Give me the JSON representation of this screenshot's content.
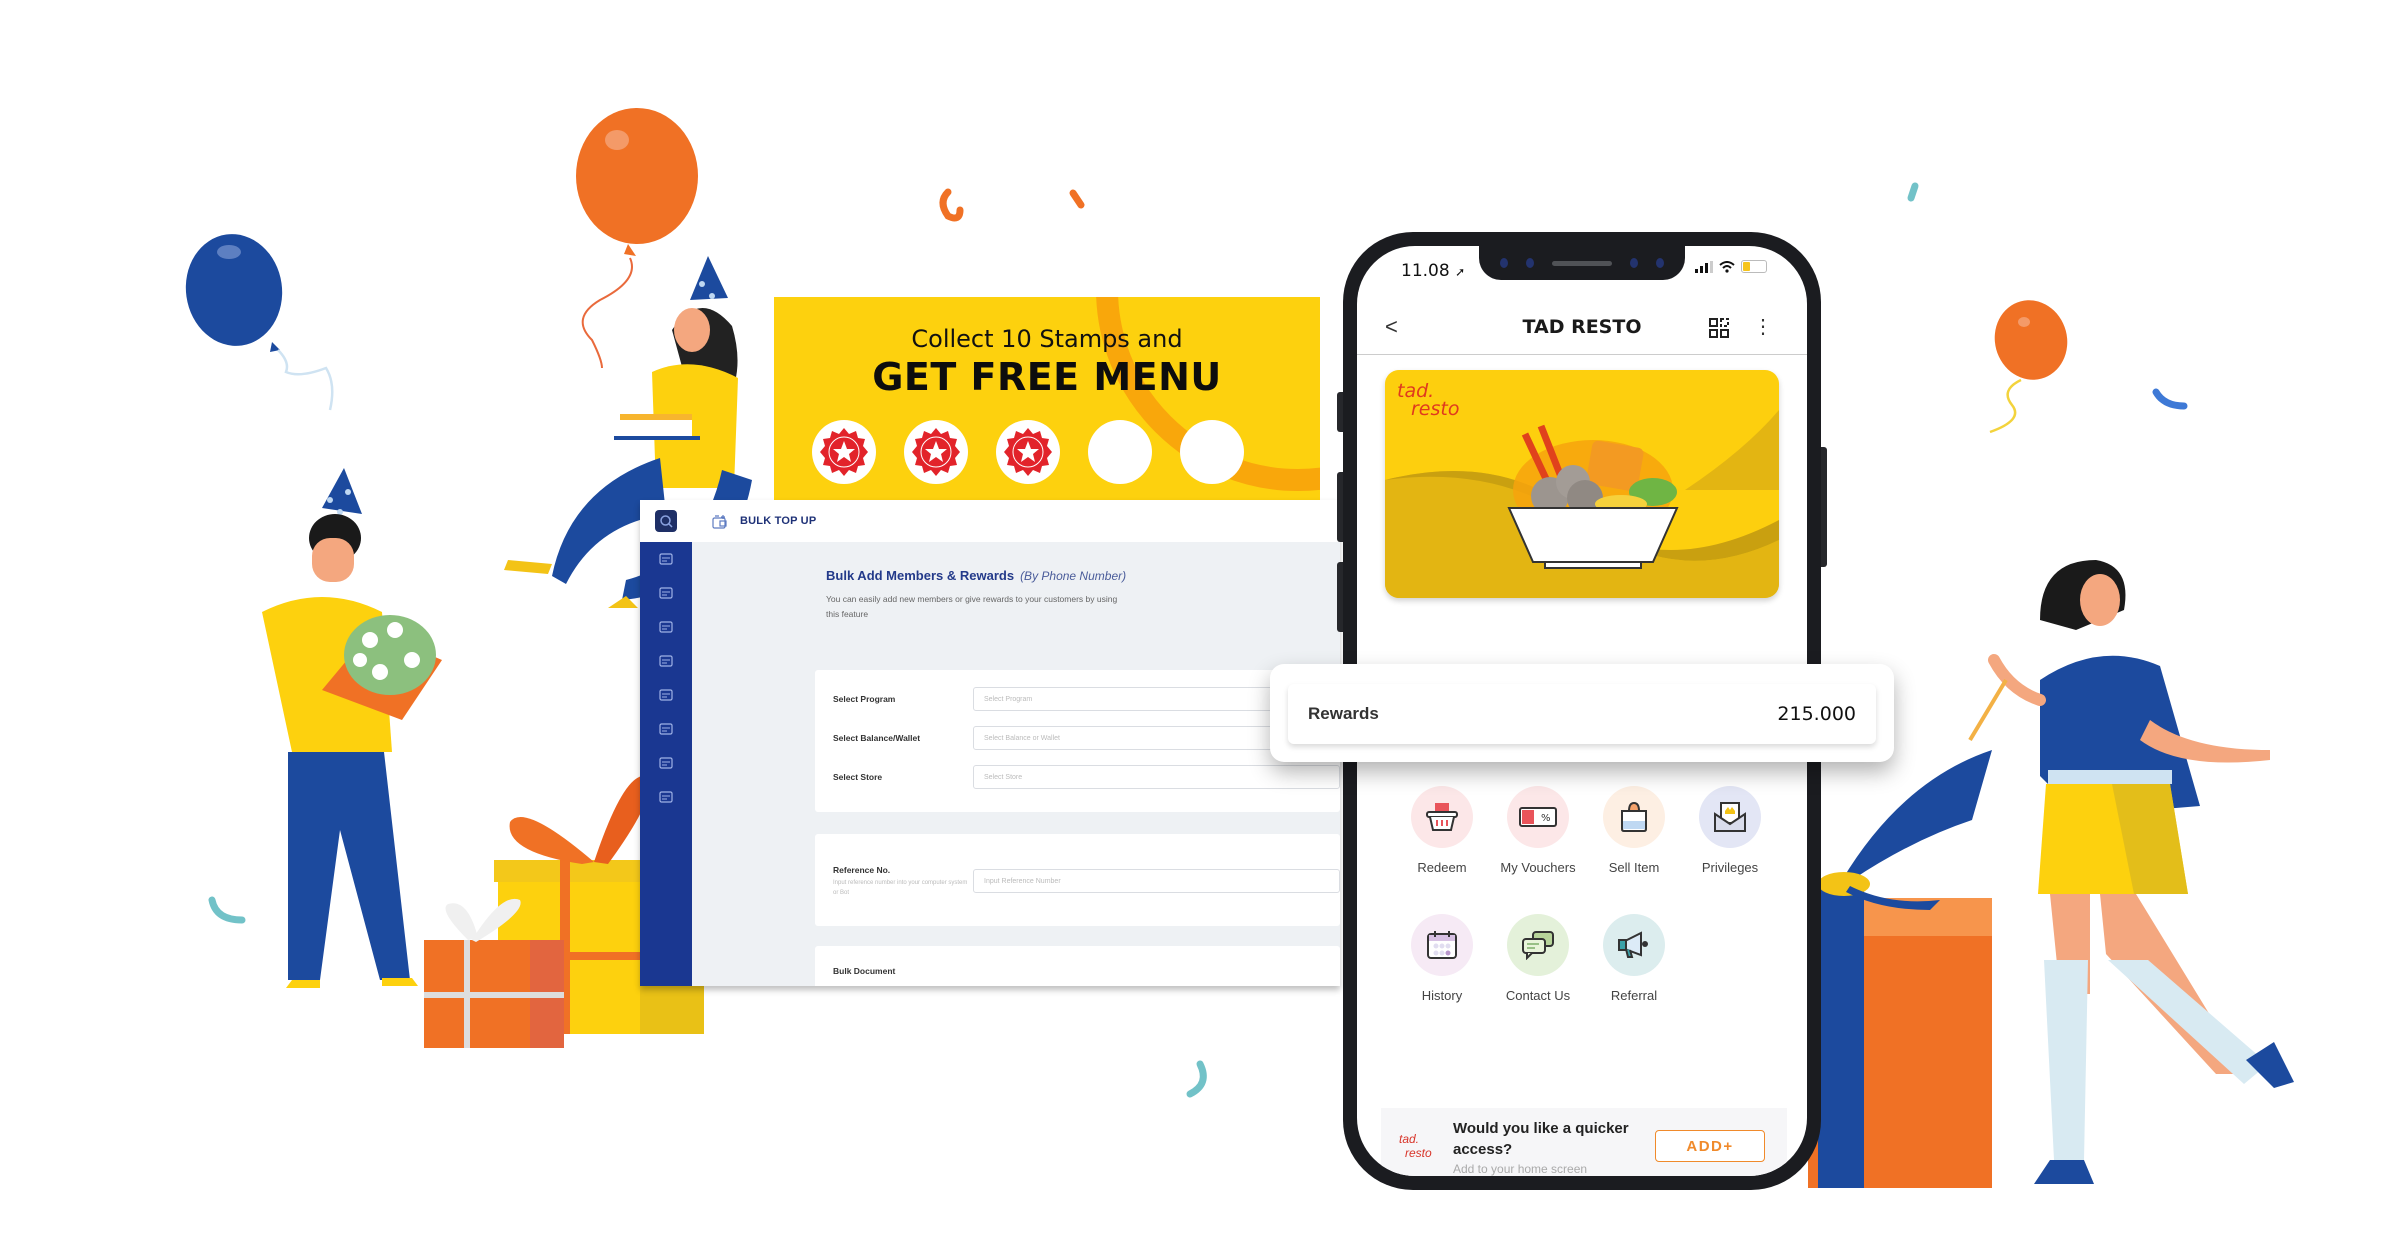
{
  "stamp_card": {
    "line1": "Collect 10 Stamps and",
    "line2": "GET FREE MENU",
    "stamps_collected": 3,
    "stamps_visible": 5,
    "colors": {
      "background": "#FDD10E",
      "arc": "#F9A70B",
      "stamp": "#E2232A"
    }
  },
  "dashboard": {
    "topbar_title": "BULK TOP UP",
    "heading": "Bulk Add Members & Rewards",
    "heading_sub": "(By Phone Number)",
    "description": "You can easily add new members or give rewards to your customers by using this feature",
    "sidebar_icons": [
      "search-logo-icon",
      "members-icon",
      "card-icon",
      "document-icon",
      "wallet-icon",
      "discount-icon",
      "store-icon",
      "report-icon",
      "settings-icon"
    ],
    "fields": [
      {
        "label": "Select Program",
        "placeholder": "Select Program"
      },
      {
        "label": "Select Balance/Wallet",
        "placeholder": "Select Balance or Wallet"
      },
      {
        "label": "Select Store",
        "placeholder": "Select Store"
      }
    ],
    "reference": {
      "label": "Reference No.",
      "hint": "Input reference number into your computer system or Bot",
      "placeholder": "Input Reference Number"
    },
    "bulk_document_label": "Bulk Document",
    "colors": {
      "sidebar": "#1A3791",
      "heading": "#233A8A"
    }
  },
  "phone": {
    "status": {
      "time": "11.08",
      "battery_level": 0.3
    },
    "header": {
      "back": "<",
      "title": "TAD RESTO",
      "more": "⋮"
    },
    "card_brand_line1": "tad.",
    "card_brand_line2": "resto",
    "rewards": {
      "label": "Rewards",
      "value": "215.000"
    },
    "menu": [
      {
        "label": "Redeem",
        "icon": "basket-icon",
        "bg": "#FCE7E8"
      },
      {
        "label": "My Vouchers",
        "icon": "voucher-icon",
        "bg": "#FCE7E8"
      },
      {
        "label": "Sell Item",
        "icon": "shopping-bag-icon",
        "bg": "#FDEFE3"
      },
      {
        "label": "Privileges",
        "icon": "crown-envelope-icon",
        "bg": "#E3E6F5"
      },
      {
        "label": "History",
        "icon": "calendar-icon",
        "bg": "#F6EAF5"
      },
      {
        "label": "Contact Us",
        "icon": "chat-icon",
        "bg": "#E4F1DA"
      },
      {
        "label": "Referral",
        "icon": "megaphone-icon",
        "bg": "#DCEDEE"
      }
    ],
    "install_banner": {
      "brand_line1": "tad.",
      "brand_line2": "resto",
      "question_line1": "Would you like a quicker",
      "question_line2": "access?",
      "sub": "Add to your home screen",
      "button": "ADD+"
    }
  },
  "palette": {
    "blue": "#1C4A9E",
    "orange": "#F07125",
    "yellow": "#FDD10E",
    "teal": "#72C2C8"
  }
}
